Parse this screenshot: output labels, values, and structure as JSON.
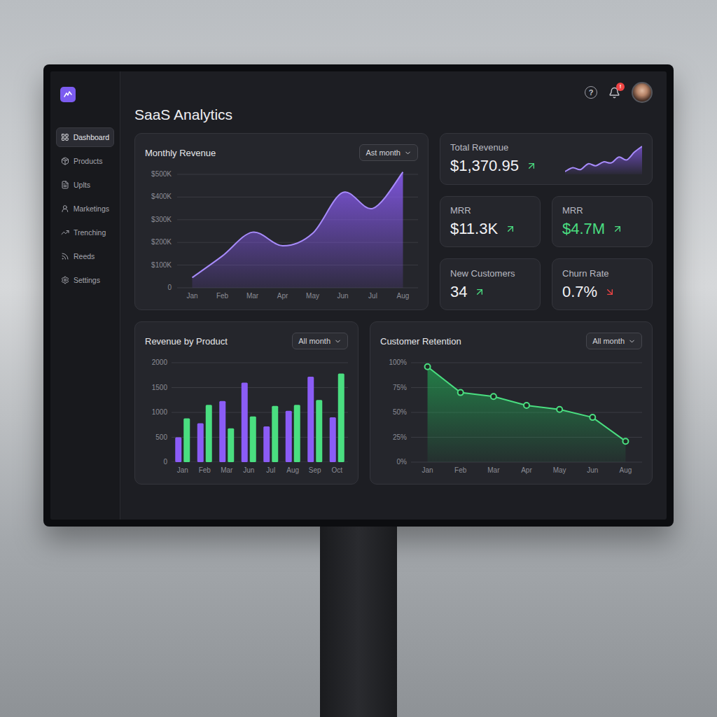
{
  "app": {
    "title": "SaaS Analytics"
  },
  "header": {
    "help": "?",
    "notification_badge": "!"
  },
  "sidebar": {
    "items": [
      {
        "label": "Dashboard",
        "selected": true
      },
      {
        "label": "Products",
        "selected": false
      },
      {
        "label": "Uplts",
        "selected": false
      },
      {
        "label": "Marketings",
        "selected": false
      },
      {
        "label": "Trenching",
        "selected": false
      },
      {
        "label": "Reeds",
        "selected": false
      },
      {
        "label": "Settings",
        "selected": false
      }
    ]
  },
  "monthly_revenue": {
    "title": "Monthly Revenue",
    "filter": "Ast month",
    "y_ticks": [
      "$500K",
      "$400K",
      "$300K",
      "$200K",
      "$100K",
      "0"
    ],
    "x_labels": [
      "Jan",
      "Feb",
      "Mar",
      "Apr",
      "May",
      "Jun",
      "Jul",
      "Aug"
    ],
    "values": [
      45,
      140,
      245,
      185,
      240,
      420,
      350,
      510
    ]
  },
  "kpis": [
    {
      "kind": "sparkline",
      "label": "Total Revenue",
      "value": "$1,370.95",
      "trend": "up",
      "highlight": false,
      "sparkline": [
        8,
        12,
        10,
        16,
        14,
        18,
        17,
        23,
        20,
        28,
        34
      ]
    },
    {
      "kind": "stat",
      "label": "MRR",
      "value": "$11.3K",
      "trend": "up",
      "highlight": false
    },
    {
      "kind": "stat",
      "label": "MRR",
      "value": "$4.7M",
      "trend": "up",
      "highlight": true
    },
    {
      "kind": "stat",
      "label": "New Customers",
      "value": "34",
      "trend": "up",
      "highlight": false
    },
    {
      "kind": "stat",
      "label": "Churn Rate",
      "value": "0.7%",
      "trend": "down",
      "highlight": false
    }
  ],
  "revenue_by_product": {
    "title": "Revenue by Product",
    "filter": "All month",
    "y_ticks": [
      "2000",
      "1500",
      "1000",
      "500",
      "0"
    ],
    "x_labels": [
      "Jan",
      "Feb",
      "Mar",
      "Jun",
      "Jul",
      "Aug",
      "Sep",
      "Oct"
    ],
    "series": [
      {
        "color": "#8b5cf6",
        "values": [
          500,
          780,
          1230,
          1600,
          720,
          1030,
          1720,
          900
        ]
      },
      {
        "color": "#4ade80",
        "values": [
          880,
          1150,
          680,
          920,
          1130,
          1150,
          1250,
          1780
        ]
      }
    ]
  },
  "customer_retention": {
    "title": "Customer Retention",
    "filter": "All month",
    "y_ticks": [
      "100%",
      "75%",
      "50%",
      "25%",
      "0%"
    ],
    "x_labels": [
      "Jan",
      "Feb",
      "Mar",
      "Apr",
      "May",
      "Jun",
      "Aug"
    ],
    "values": [
      96,
      70,
      66,
      57,
      53,
      45,
      21
    ]
  }
}
